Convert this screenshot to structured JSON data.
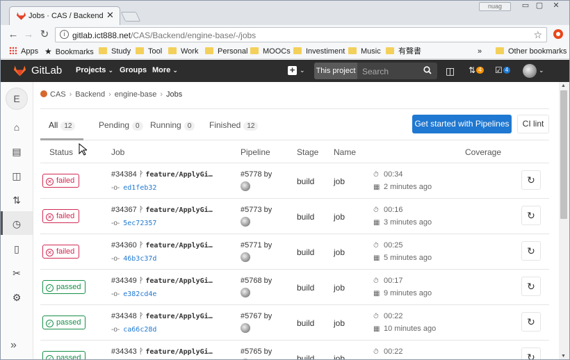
{
  "browser": {
    "tab_title": "Jobs · CAS / Backend / engine-base",
    "tab_title_visible": "Jobs · CAS / Backend / e",
    "url_host": "gitlab.ict888.net",
    "url_path": "/CAS/Backend/engine-base/-/jobs",
    "user_badge": "nuag"
  },
  "bookmarks": {
    "apps": "Apps",
    "bookmarks": "Bookmarks",
    "items": [
      "Study",
      "Tool",
      "Work",
      "Personal",
      "MOOCs",
      "Investiment",
      "Music",
      "有聲書"
    ],
    "overflow": "»",
    "other": "Other bookmarks"
  },
  "navbar": {
    "brand": "GitLab",
    "projects": "Projects",
    "groups": "Groups",
    "more": "More",
    "search_scope": "This project",
    "search_placeholder": "Search",
    "mr_count": "4",
    "todo_count": "4"
  },
  "sidebar": {
    "project_letter": "E"
  },
  "breadcrumb": {
    "group": "CAS",
    "subgroup": "Backend",
    "project": "engine-base",
    "current": "Jobs",
    "sep": "›"
  },
  "tabs": [
    {
      "label": "All",
      "count": "12"
    },
    {
      "label": "Pending",
      "count": "0"
    },
    {
      "label": "Running",
      "count": "0"
    },
    {
      "label": "Finished",
      "count": "12"
    }
  ],
  "actions": {
    "get_started": "Get started with Pipelines",
    "ci_lint": "CI lint"
  },
  "columns": [
    "Status",
    "Job",
    "Pipeline",
    "Stage",
    "Name",
    "Coverage"
  ],
  "jobs": [
    {
      "status": "failed",
      "id": "#34384",
      "branch": "feature/ApplyGi…",
      "sha": "ed1feb32",
      "pipeline": "#5778 by",
      "stage": "build",
      "name": "job",
      "duration": "00:34",
      "ago": "2 minutes ago"
    },
    {
      "status": "failed",
      "id": "#34367",
      "branch": "feature/ApplyGi…",
      "sha": "5ec72357",
      "pipeline": "#5773 by",
      "stage": "build",
      "name": "job",
      "duration": "00:16",
      "ago": "3 minutes ago"
    },
    {
      "status": "failed",
      "id": "#34360",
      "branch": "feature/ApplyGi…",
      "sha": "46b3c37d",
      "pipeline": "#5771 by",
      "stage": "build",
      "name": "job",
      "duration": "00:25",
      "ago": "5 minutes ago"
    },
    {
      "status": "passed",
      "id": "#34349",
      "branch": "feature/ApplyGi…",
      "sha": "e382cd4e",
      "pipeline": "#5768 by",
      "stage": "build",
      "name": "job",
      "duration": "00:17",
      "ago": "9 minutes ago"
    },
    {
      "status": "passed",
      "id": "#34348",
      "branch": "feature/ApplyGi…",
      "sha": "ca66c28d",
      "pipeline": "#5767 by",
      "stage": "build",
      "name": "job",
      "duration": "00:22",
      "ago": "10 minutes ago"
    },
    {
      "status": "passed",
      "id": "#34343",
      "branch": "feature/ApplyGi…",
      "sha": "",
      "pipeline": "#5765 by",
      "stage": "build",
      "name": "job",
      "duration": "00:22",
      "ago": ""
    }
  ],
  "colors": {
    "navbar_bg": "#2d2d2d",
    "primary": "#1f78d1",
    "failed": "#d22852",
    "passed": "#168f48",
    "badge_orange": "#fc9403"
  }
}
